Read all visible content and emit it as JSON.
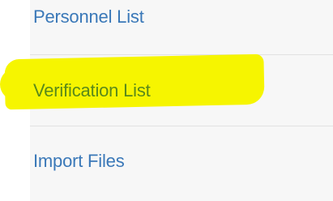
{
  "nav": {
    "items": [
      {
        "label": "Personnel List"
      },
      {
        "label": "Verification List"
      },
      {
        "label": "Import Files"
      }
    ]
  },
  "colors": {
    "link": "#3a78b8",
    "highlighted_link": "#5a8a1a",
    "highlight": "#f6f500",
    "panel_background": "#f7f7f7",
    "divider": "#e2e2e2"
  }
}
